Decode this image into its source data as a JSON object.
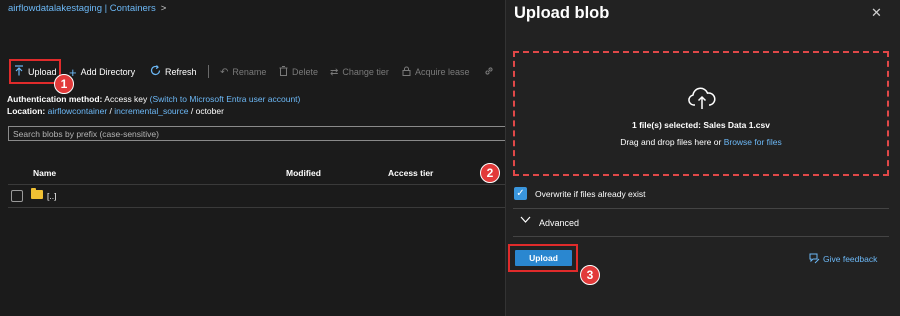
{
  "breadcrumb": {
    "text": "airflowdatalakestaging | Containers",
    "chevron": ">"
  },
  "toolbar": {
    "upload": {
      "label": "Upload",
      "icon": "upload-icon"
    },
    "add_directory": {
      "label": "Add Directory",
      "icon": "plus-icon"
    },
    "refresh": {
      "label": "Refresh",
      "icon": "refresh-icon"
    },
    "rename": {
      "label": "Rename",
      "icon": "undo-icon"
    },
    "delete": {
      "label": "Delete",
      "icon": "trash-icon"
    },
    "change_tier": {
      "label": "Change tier",
      "icon": "swap-icon"
    },
    "acquire_lease": {
      "label": "Acquire lease",
      "icon": "lock-icon"
    },
    "more_icon": "link-icon"
  },
  "auth": {
    "label": "Authentication method:",
    "value": "Access key",
    "switch_link": "(Switch to Microsoft Entra user account)"
  },
  "location": {
    "label": "Location:",
    "container": "airflowcontainer",
    "sep1": "/",
    "folder": "incremental_source",
    "sep2": "/",
    "current": "october"
  },
  "search": {
    "placeholder": "Search blobs by prefix (case-sensitive)"
  },
  "table": {
    "headers": {
      "name": "Name",
      "modified": "Modified",
      "access_tier": "Access tier"
    },
    "rows": [
      {
        "name": "[..]",
        "icon": "folder-icon"
      }
    ]
  },
  "panel": {
    "title": "Upload blob",
    "close": "✕",
    "files_selected": "1 file(s) selected: Sales Data 1.csv",
    "drag_text": "Drag and drop files here  or ",
    "browse_link": "Browse for files",
    "overwrite_label": "Overwrite if files already exist",
    "advanced_label": "Advanced",
    "upload_button": "Upload",
    "feedback_link": "Give feedback"
  },
  "callouts": [
    "1",
    "2",
    "3"
  ],
  "colors": {
    "accent": "#2a87d0",
    "link": "#6cb8f6",
    "callout": "#e02b2b",
    "background": "#1b1b1b",
    "panel": "#222222"
  }
}
